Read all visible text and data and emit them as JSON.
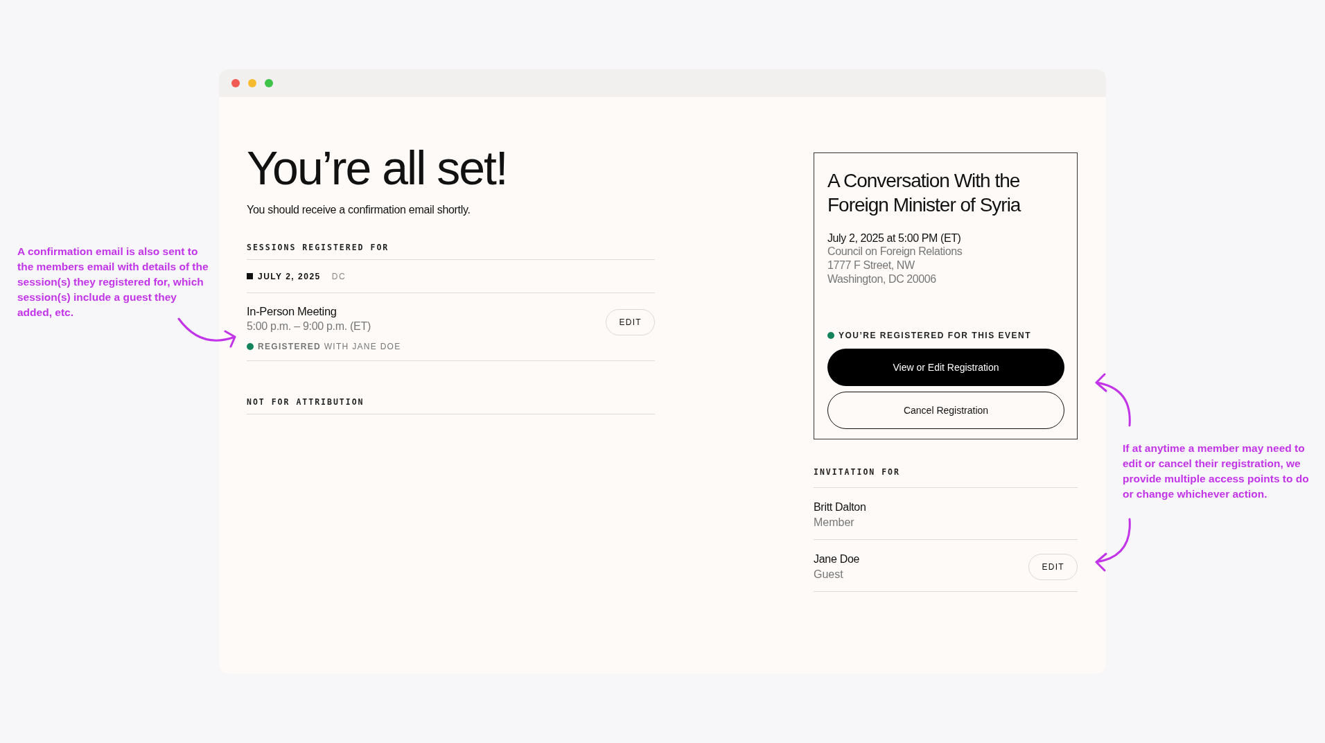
{
  "annotations": [
    {
      "text": "A confirmation email is also sent to the members email with details of the session(s) they registered for, which session(s) include a guest they added, etc."
    },
    {
      "text": "If at anytime a member may need to edit or cancel their registration, we provide multiple access points to do or change whichever action."
    }
  ],
  "confirmation": {
    "heading": "You’re all set!",
    "subtitle": "You should receive a confirmation email shortly.",
    "sessions_label": "SESSIONS REGISTERED FOR",
    "date": "JULY 2, 2025",
    "location": "DC",
    "sessions": [
      {
        "title": "In-Person Meeting",
        "time": "5:00 p.m. – 9:00 p.m. (ET)",
        "registered": true,
        "status": "**REGISTERED** WITH JANE DOE",
        "edit": "EDIT"
      }
    ],
    "attribution_label": "NOT FOR ATTRIBUTION"
  },
  "event_card": {
    "title": "A Conversation With the Foreign Minister of Syria",
    "datetime": "July 2, 2025 at 5:00 PM (ET)",
    "address": [
      "Council on Foreign Relations",
      "1777 F Street, NW",
      "Washington, DC 20006"
    ],
    "registered": true,
    "status": "YOU’RE REGISTERED FOR THIS EVENT",
    "buttons": [
      {
        "label": "View or Edit Registration",
        "kind": "primary"
      },
      {
        "label": "Cancel Registration",
        "kind": "outline"
      }
    ]
  },
  "invitation": {
    "label": "INVITATION FOR",
    "people": [
      {
        "name": "Britt Dalton",
        "role": "Member"
      },
      {
        "name": "Jane Doe",
        "role": "Guest",
        "edit": "EDIT"
      }
    ]
  }
}
